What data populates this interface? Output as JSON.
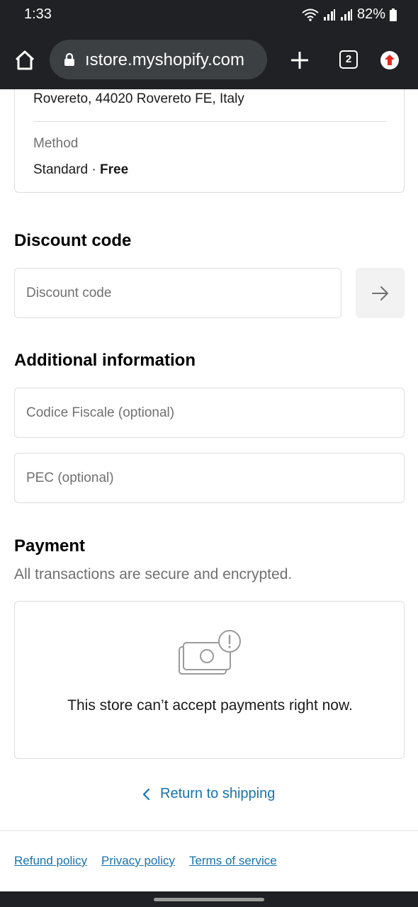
{
  "status_bar": {
    "time": "1:33",
    "battery": "82%"
  },
  "browser": {
    "url": "ıstore.myshopify.com",
    "tab_count": "2"
  },
  "shipping": {
    "address": "Rovereto, 44020 Rovereto FE, Italy",
    "method_label": "Method",
    "method_name": "Standard",
    "method_separator": " · ",
    "method_price": "Free"
  },
  "discount": {
    "title": "Discount code",
    "placeholder": "Discount code"
  },
  "additional": {
    "title": "Additional information",
    "codice_placeholder": "Codice Fiscale (optional)",
    "pec_placeholder": "PEC (optional)"
  },
  "payment": {
    "title": "Payment",
    "subtitle": "All transactions are secure and encrypted.",
    "message": "This store can’t accept payments right now."
  },
  "navigation": {
    "return_label": "Return to shipping"
  },
  "footer": {
    "refund": "Refund policy",
    "privacy": "Privacy policy",
    "terms": "Terms of service"
  },
  "colors": {
    "link": "#1773b0",
    "muted_text": "#707070",
    "border": "#dedede",
    "browser_chrome": "#202124",
    "update_badge": "#e8281e"
  }
}
